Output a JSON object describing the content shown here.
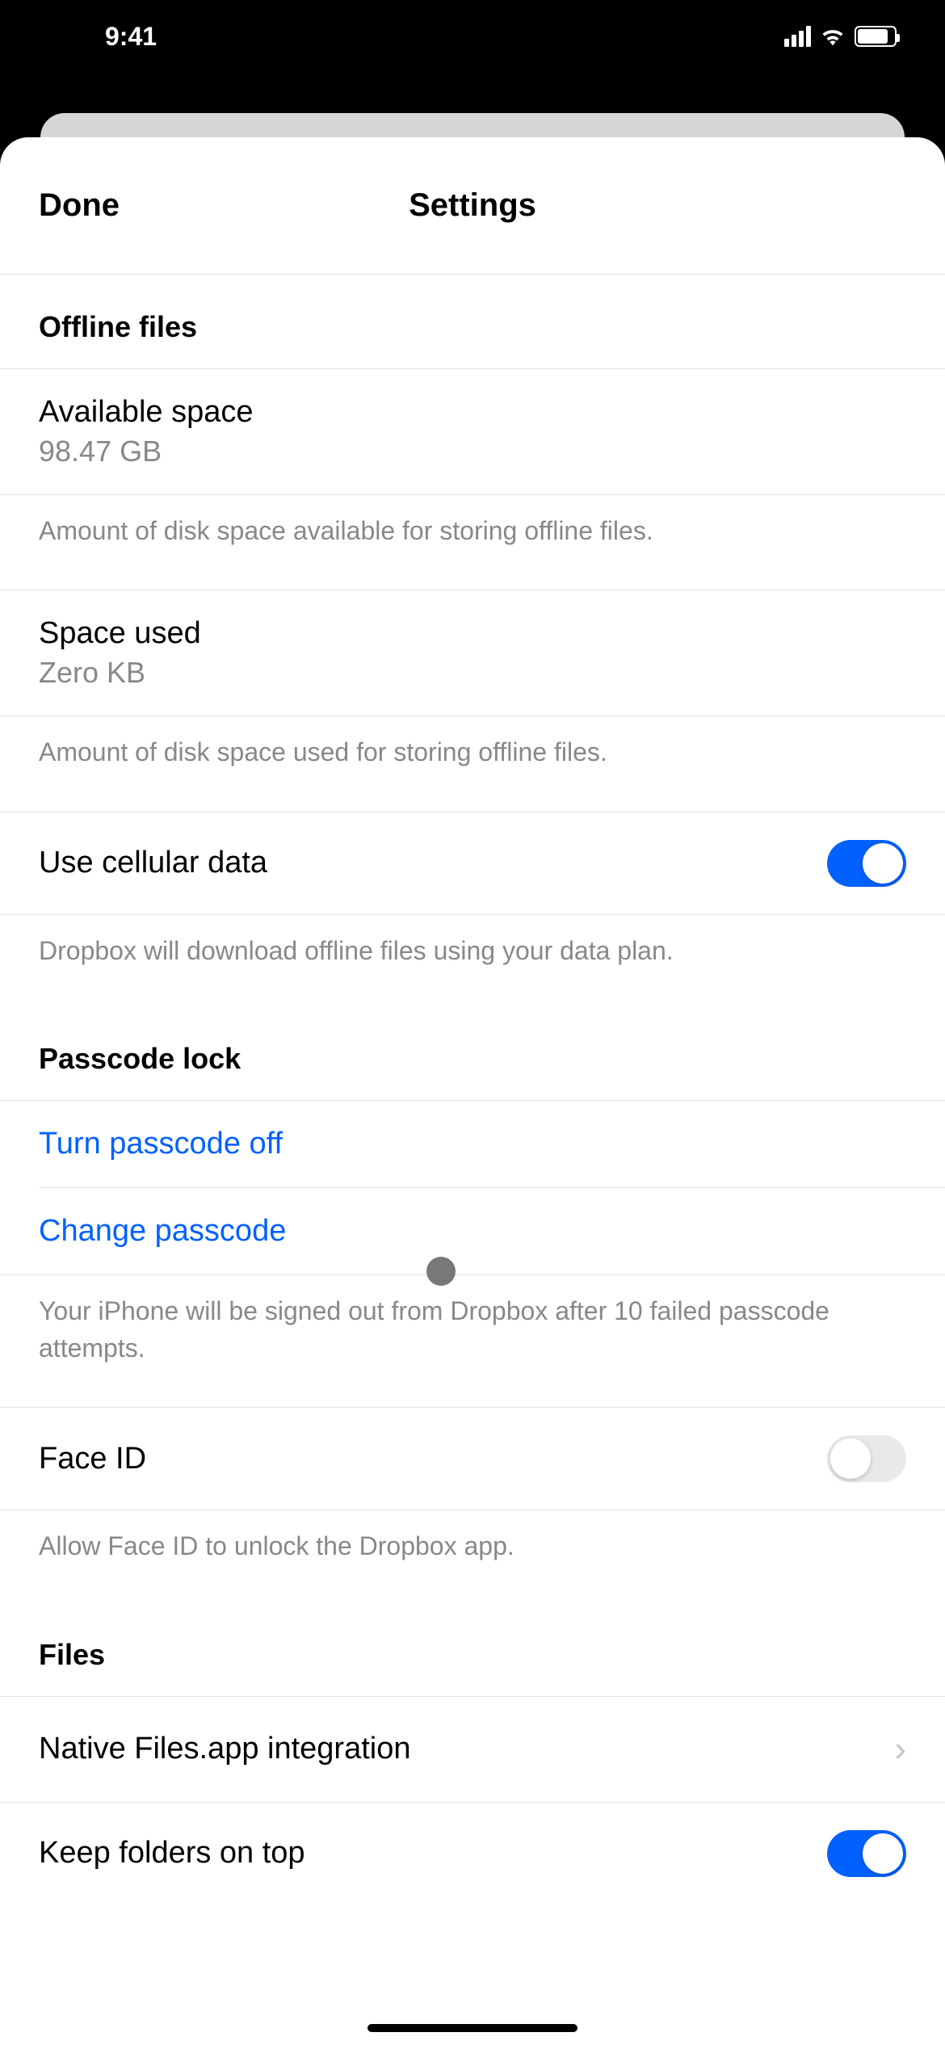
{
  "status": {
    "time": "9:41"
  },
  "nav": {
    "done": "Done",
    "title": "Settings"
  },
  "sections": {
    "offline": {
      "header": "Offline files",
      "available_label": "Available space",
      "available_value": "98.47 GB",
      "available_footer": "Amount of disk space available for storing offline files.",
      "used_label": "Space used",
      "used_value": "Zero KB",
      "used_footer": "Amount of disk space used for storing offline files.",
      "cellular_label": "Use cellular data",
      "cellular_footer": "Dropbox will download offline files using your data plan."
    },
    "passcode": {
      "header": "Passcode lock",
      "turn_off": "Turn passcode off",
      "change": "Change passcode",
      "footer": "Your iPhone will be signed out from Dropbox after 10 failed passcode attempts.",
      "faceid_label": "Face ID",
      "faceid_footer": "Allow Face ID to unlock the Dropbox app."
    },
    "files": {
      "header": "Files",
      "native_label": "Native Files.app integration",
      "keep_folders_label": "Keep folders on top"
    }
  }
}
